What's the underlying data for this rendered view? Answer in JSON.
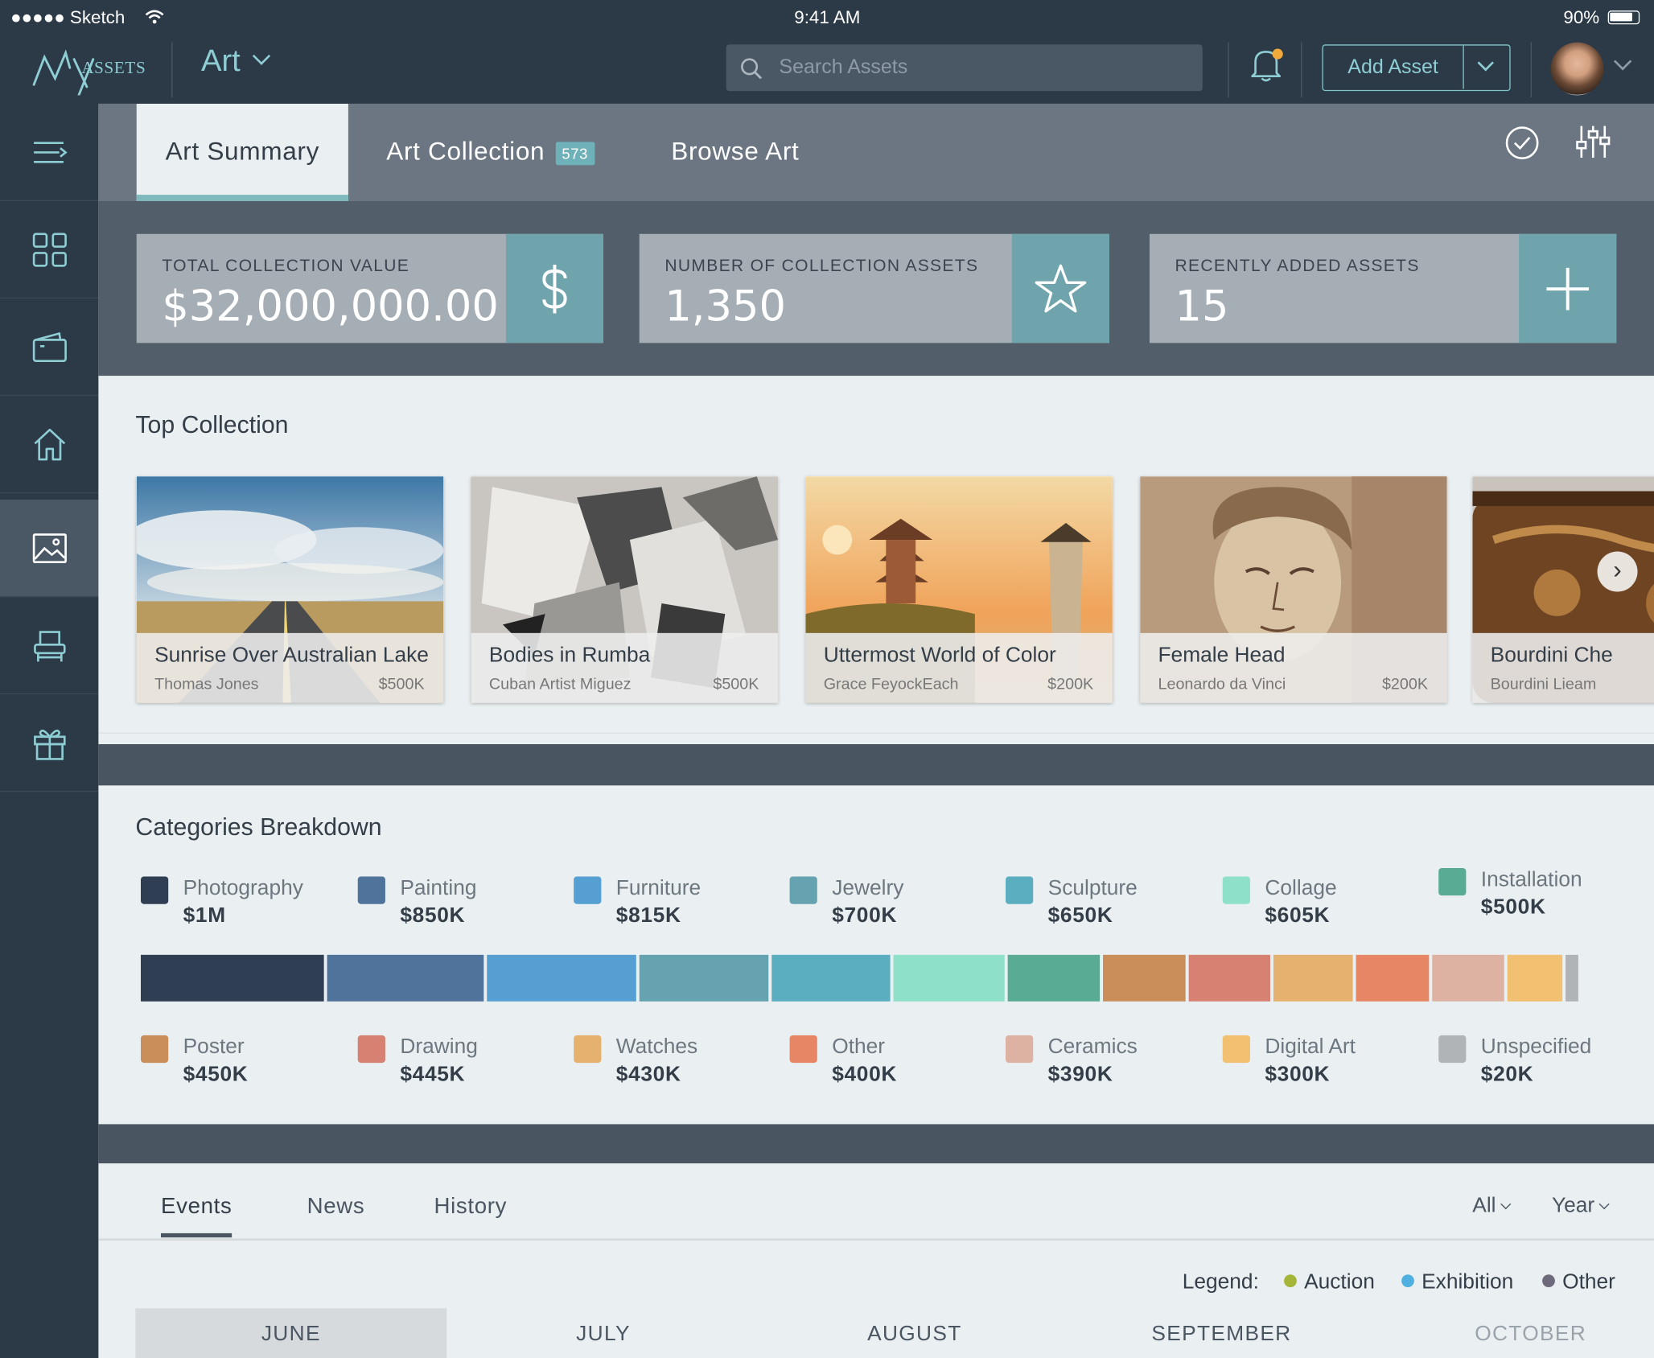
{
  "status_bar": {
    "carrier": "●●●●● Sketch",
    "time": "9:41 AM",
    "battery": "90%"
  },
  "header": {
    "logo_text": "ASSETS",
    "section": "Art",
    "search_placeholder": "Search Assets",
    "add_button": "Add Asset"
  },
  "sidebar": {
    "items": [
      {
        "icon": "menu-icon"
      },
      {
        "icon": "grid-icon"
      },
      {
        "icon": "wallet-icon"
      },
      {
        "icon": "home-icon"
      },
      {
        "icon": "image-icon",
        "active": true
      },
      {
        "icon": "chair-icon"
      },
      {
        "icon": "gift-icon"
      }
    ]
  },
  "tabs": {
    "summary": "Art Summary",
    "collection": "Art Collection",
    "collection_count": "573",
    "browse": "Browse Art"
  },
  "kpis": [
    {
      "title": "TOTAL COLLECTION VALUE",
      "value": "$32,000,000.00",
      "icon": "dollar-icon"
    },
    {
      "title": "NUMBER OF COLLECTION ASSETS",
      "value": "1,350",
      "icon": "star-icon"
    },
    {
      "title": "RECENTLY ADDED ASSETS",
      "value": "15",
      "icon": "plus-icon"
    }
  ],
  "top_collection": {
    "title": "Top Collection",
    "items": [
      {
        "name": "Sunrise Over Australian Lake",
        "artist": "Thomas Jones",
        "price": "$500K"
      },
      {
        "name": "Bodies in Rumba",
        "artist": "Cuban Artist Miguez",
        "price": "$500K"
      },
      {
        "name": "Uttermost World of Color",
        "artist": "Grace FeyockEach",
        "price": "$200K"
      },
      {
        "name": "Female Head",
        "artist": "Leonardo da Vinci",
        "price": "$200K"
      },
      {
        "name": "Bourdini Che",
        "artist": "Bourdini Lieam",
        "price": ""
      }
    ]
  },
  "categories": {
    "title": "Categories Breakdown",
    "items": [
      {
        "name": "Photography",
        "value": "$1M",
        "amount": 1000,
        "color": "#2f3e52"
      },
      {
        "name": "Painting",
        "value": "$850K",
        "amount": 850,
        "color": "#4f739b"
      },
      {
        "name": "Furniture",
        "value": "$815K",
        "amount": 815,
        "color": "#559fd3"
      },
      {
        "name": "Jewelry",
        "value": "$700K",
        "amount": 700,
        "color": "#65a3b0"
      },
      {
        "name": "Sculpture",
        "value": "$650K",
        "amount": 650,
        "color": "#5aaec0"
      },
      {
        "name": "Collage",
        "value": "$605K",
        "amount": 605,
        "color": "#8ee0c9"
      },
      {
        "name": "Installation",
        "value": "$500K",
        "amount": 500,
        "color": "#5aab94"
      },
      {
        "name": "Poster",
        "value": "$450K",
        "amount": 450,
        "color": "#c98e5a"
      },
      {
        "name": "Drawing",
        "value": "$445K",
        "amount": 445,
        "color": "#d68172"
      },
      {
        "name": "Watches",
        "value": "$430K",
        "amount": 430,
        "color": "#e4b26e"
      },
      {
        "name": "Other",
        "value": "$400K",
        "amount": 400,
        "color": "#e68665"
      },
      {
        "name": "Ceramics",
        "value": "$390K",
        "amount": 390,
        "color": "#ddb2a3"
      },
      {
        "name": "Digital Art",
        "value": "$300K",
        "amount": 300,
        "color": "#f1c171"
      },
      {
        "name": "Unspecified",
        "value": "$20K",
        "amount": 20,
        "color": "#b1b4b6"
      }
    ]
  },
  "events": {
    "tabs": [
      "Events",
      "News",
      "History"
    ],
    "filter_all": "All",
    "filter_year": "Year",
    "legend_label": "Legend:",
    "legend": [
      {
        "name": "Auction",
        "color": "#a4b53a"
      },
      {
        "name": "Exhibition",
        "color": "#4fb0df"
      },
      {
        "name": "Other",
        "color": "#6e6a7c"
      }
    ],
    "months": [
      "JUNE",
      "JULY",
      "AUGUST",
      "SEPTEMBER",
      "OCTOBER"
    ]
  }
}
